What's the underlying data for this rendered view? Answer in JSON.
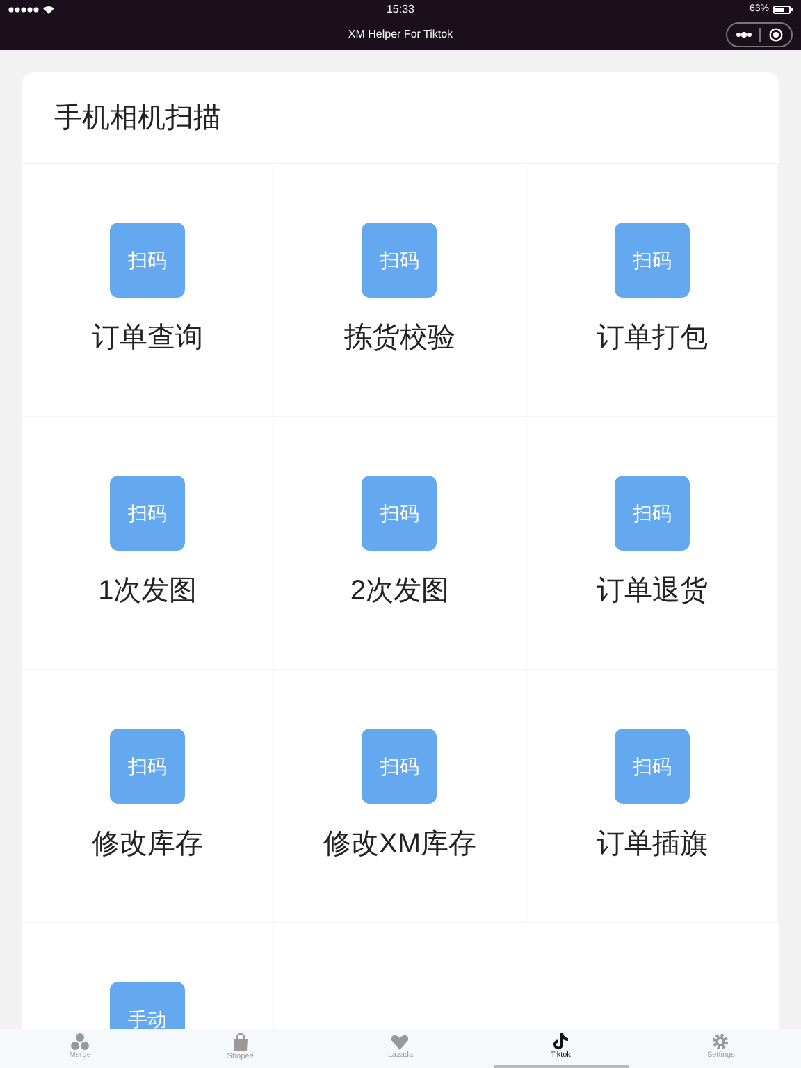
{
  "status_bar": {
    "time": "15:33",
    "battery": "63%"
  },
  "nav_bar": {
    "title": "XM Helper For Tiktok"
  },
  "card": {
    "title": "手机相机扫描",
    "items": [
      {
        "button": "扫码",
        "label": "订单查询"
      },
      {
        "button": "扫码",
        "label": "拣货校验"
      },
      {
        "button": "扫码",
        "label": "订单打包"
      },
      {
        "button": "扫码",
        "label": "1次发图"
      },
      {
        "button": "扫码",
        "label": "2次发图"
      },
      {
        "button": "扫码",
        "label": "订单退货"
      },
      {
        "button": "扫码",
        "label": "修改库存"
      },
      {
        "button": "扫码",
        "label": "修改XM库存"
      },
      {
        "button": "扫码",
        "label": "订单插旗"
      },
      {
        "button": "手动"
      }
    ]
  },
  "tab_bar": [
    {
      "kind": "merge",
      "label": "Merge",
      "selected": false
    },
    {
      "kind": "shopee",
      "label": "Shopee",
      "selected": false
    },
    {
      "kind": "lazada",
      "label": "Lazada",
      "selected": false
    },
    {
      "kind": "tiktok",
      "label": "Tiktok",
      "selected": true
    },
    {
      "kind": "settings",
      "label": "Settings",
      "selected": false
    }
  ]
}
